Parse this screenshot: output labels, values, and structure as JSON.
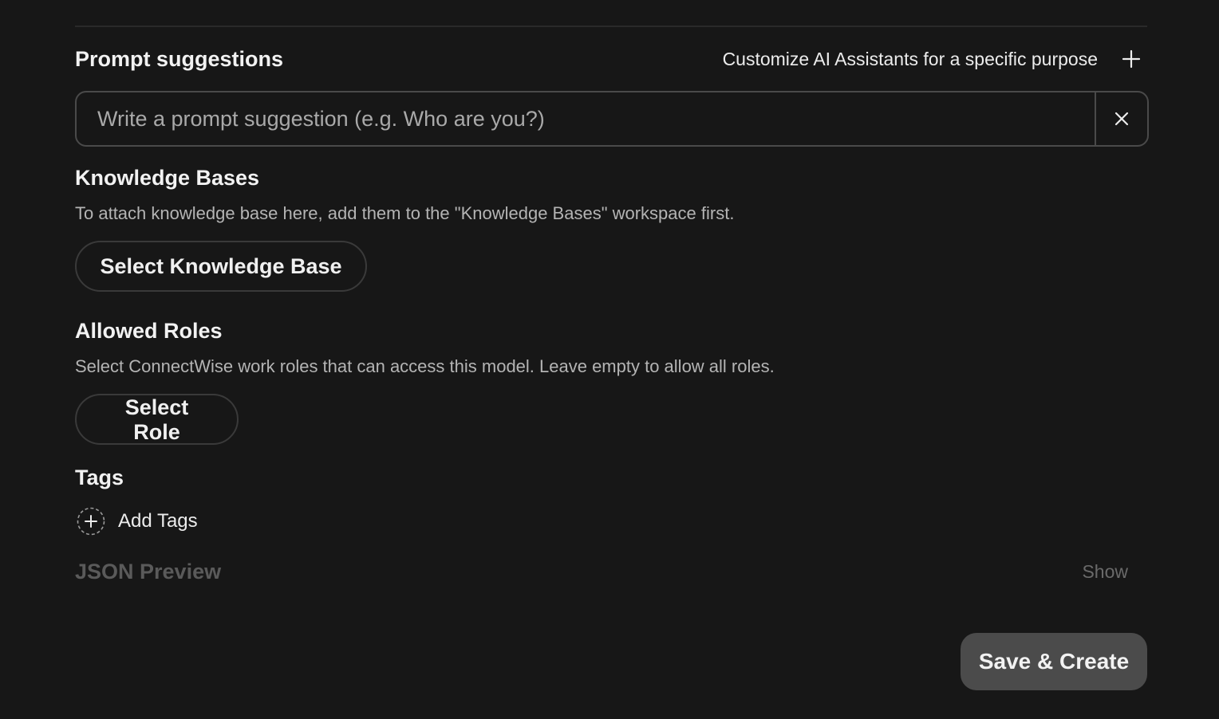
{
  "prompt_suggestions": {
    "title": "Prompt suggestions",
    "customize_text": "Customize AI Assistants for a specific purpose",
    "input_placeholder": "Write a prompt suggestion (e.g. Who are you?)",
    "input_value": "",
    "add_icon": "plus-icon",
    "clear_icon": "close-icon"
  },
  "knowledge_bases": {
    "title": "Knowledge Bases",
    "description": "To attach knowledge base here, add them to the \"Knowledge Bases\" workspace first.",
    "button_label": "Select Knowledge Base"
  },
  "allowed_roles": {
    "title": "Allowed Roles",
    "description": "Select ConnectWise work roles that can access this model. Leave empty to allow all roles.",
    "button_label": "Select Role"
  },
  "tags": {
    "title": "Tags",
    "add_label": "Add Tags",
    "add_icon": "plus-circle-dashed-icon"
  },
  "json_preview": {
    "title": "JSON Preview",
    "toggle_label": "Show"
  },
  "footer": {
    "save_label": "Save & Create"
  },
  "colors": {
    "background": "#171717",
    "border": "#4a4a4a",
    "save_button": "#4b4b4b",
    "muted_text": "#5a5a5a"
  }
}
